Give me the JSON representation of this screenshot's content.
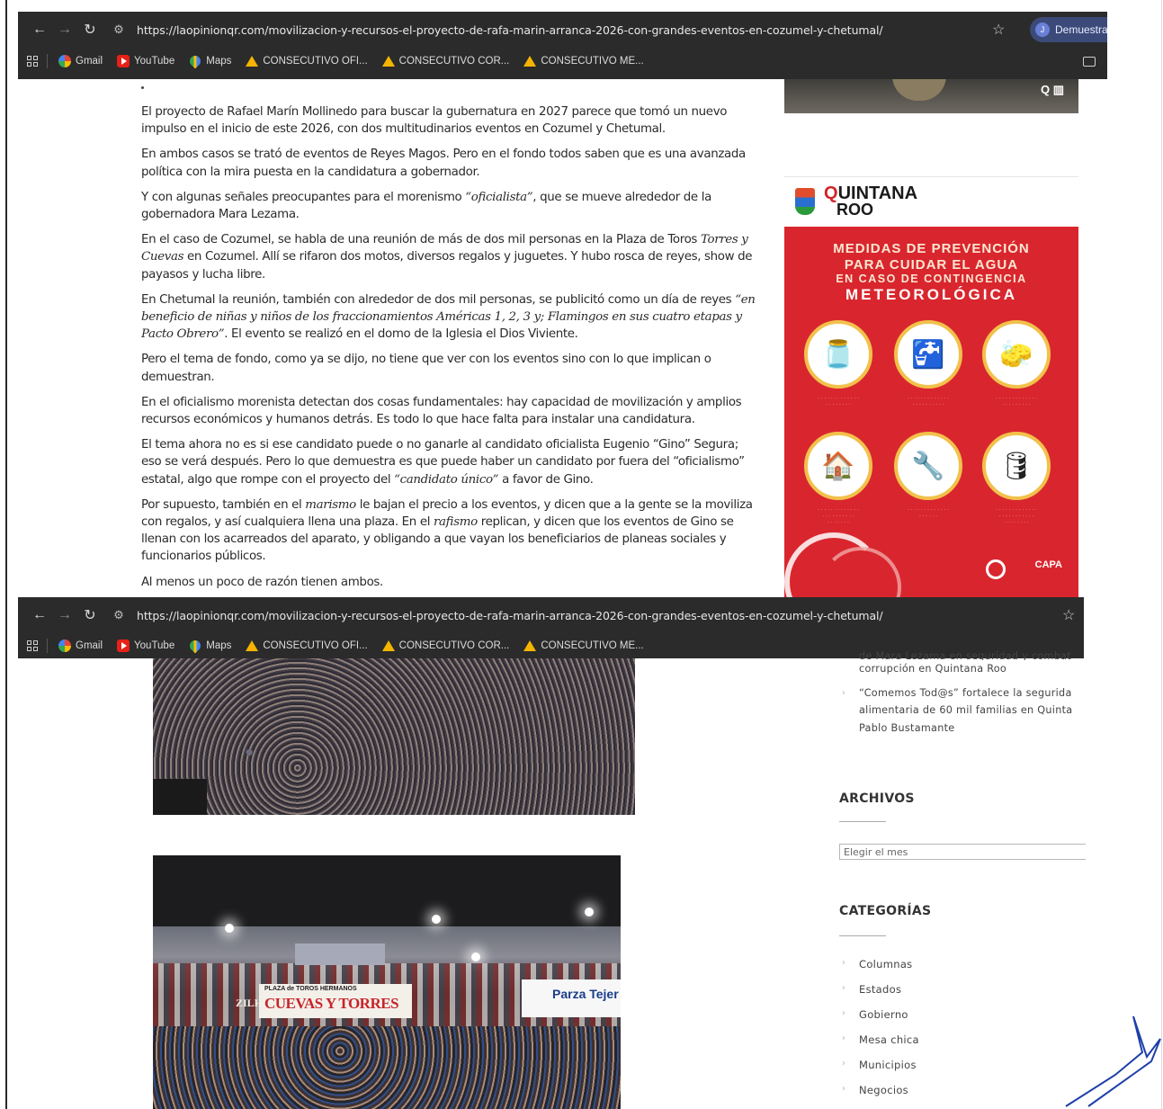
{
  "browser": {
    "url": "https://laopinionqr.com/movilizacion-y-recursos-el-proyecto-de-rafa-marin-arranca-2026-con-grandes-eventos-en-cozumel-y-chetumal/",
    "profile_label": "Demuestra",
    "bookmarks": [
      {
        "label": "Gmail",
        "icon": "google-icon"
      },
      {
        "label": "YouTube",
        "icon": "youtube-icon"
      },
      {
        "label": "Maps",
        "icon": "maps-icon"
      },
      {
        "label": "CONSECUTIVO OFI...",
        "icon": "drive-icon"
      },
      {
        "label": "CONSECUTIVO COR...",
        "icon": "drive-icon"
      },
      {
        "label": "CONSECUTIVO ME...",
        "icon": "drive-icon"
      }
    ]
  },
  "article": {
    "paragraphs": [
      {
        "parts": [
          {
            "t": "El proyecto de Rafael Marín Mollinedo para buscar la gubernatura en 2027 parece que tomó un nuevo impulso en el inicio de este 2026, con dos multitudinarios eventos en Cozumel y Chetumal."
          }
        ]
      },
      {
        "parts": [
          {
            "t": "En ambos casos se trató de eventos de Reyes Magos. Pero en el fondo todos saben que es una avanzada política con la  mira puesta en la candidatura a gobernador."
          }
        ]
      },
      {
        "parts": [
          {
            "t": "Y con algunas señales preocupantes para el morenismo "
          },
          {
            "t": "“oficialista”",
            "em": true
          },
          {
            "t": ", que se mueve alrededor de la gobernadora Mara Lezama."
          }
        ]
      },
      {
        "parts": [
          {
            "t": "En el caso de Cozumel, se habla de una reunión de más de dos mil personas en la Plaza de Toros "
          },
          {
            "t": "Torres y Cuevas",
            "em": true
          },
          {
            "t": " en Cozumel. Allí se rifaron dos motos, diversos regalos y juguetes. Y hubo rosca de reyes, show de payasos y lucha libre."
          }
        ]
      },
      {
        "parts": [
          {
            "t": "En Chetumal la reunión, también con alrededor de dos mil personas, se publicitó como un día de reyes "
          },
          {
            "t": "“en beneficio de niñas y niños de los fraccionamientos Américas 1, 2, 3 y; Flamingos en sus cuatro etapas y Pacto Obrero”",
            "em": true
          },
          {
            "t": ". El evento se realizó en el domo de la Iglesia el Dios Viviente."
          }
        ]
      },
      {
        "parts": [
          {
            "t": "Pero el tema de fondo, como ya se dijo, no tiene que ver con los eventos sino con lo que implican o demuestran."
          }
        ]
      },
      {
        "parts": [
          {
            "t": "En el oficialismo morenista detectan dos cosas fundamentales: hay capacidad de movilización y amplios recursos económicos y humanos detrás. Es todo lo que hace falta para instalar una candidatura."
          }
        ]
      },
      {
        "parts": [
          {
            "t": "El tema ahora no es si ese candidato puede o no ganarle al candidato oficialista Eugenio “Gino” Segura; eso se verá después. Pero lo que demuestra es que puede haber un candidato por fuera del “oficialismo” estatal, algo que rompe con el proyecto del "
          },
          {
            "t": "“candidato único”",
            "em": true
          },
          {
            "t": " a favor de Gino."
          }
        ]
      },
      {
        "parts": [
          {
            "t": "Por supuesto, también en el "
          },
          {
            "t": "marismo",
            "em": true
          },
          {
            "t": " le bajan el precio a los eventos, y dicen que a la gente se la moviliza con regalos, y así cualquiera llena una plaza. En el "
          },
          {
            "t": "rafismo",
            "em": true
          },
          {
            "t": " replican, y dicen que los eventos de Gino se llenan con los acarreados del aparato, y obligando a que vayan los beneficiarios de planeas sociales y funcionarios públicos."
          }
        ]
      },
      {
        "parts": [
          {
            "t": "Al menos un poco de razón tienen ambos."
          }
        ]
      }
    ]
  },
  "ad": {
    "brand": "UINTANA",
    "brand_line2": "ROO",
    "title_1": "MEDIDAS DE PREVENCIÓN",
    "title_2": "PARA CUIDAR EL AGUA",
    "title_3": "EN CASO DE CONTINGENCIA",
    "title_4": "METEOROLÓGICA",
    "capa": "CAPA",
    "icons": [
      "water-jug-icon",
      "faucet-bucket-icon",
      "sponge-icon",
      "house-broom-icon",
      "pipe-valve-icon",
      "water-tank-icon"
    ]
  },
  "photo2_signs": {
    "zilh": "ZILH",
    "plaza": "PLAZA de TOROS    HERMANOS",
    "cuevas": "CUEVAS Y TORRES",
    "parza": "Parza Tejer"
  },
  "sidebar": {
    "recent_posts": [
      {
        "line1": "de Mara Lezama en seguridad y combat",
        "line2": "corrupción en Quintana Roo"
      },
      {
        "line1": "“Comemos Tod@s” fortalece la segurida",
        "line2": "alimentaria de 60 mil familias en Quinta",
        "line3": "Pablo Bustamante"
      }
    ],
    "archives_heading": "ARCHIVOS",
    "archives_placeholder": "Elegir el mes",
    "categories_heading": "CATEGORÍAS",
    "categories": [
      "Columnas",
      "Estados",
      "Gobierno",
      "Mesa chica",
      "Municipios",
      "Negocios"
    ]
  }
}
